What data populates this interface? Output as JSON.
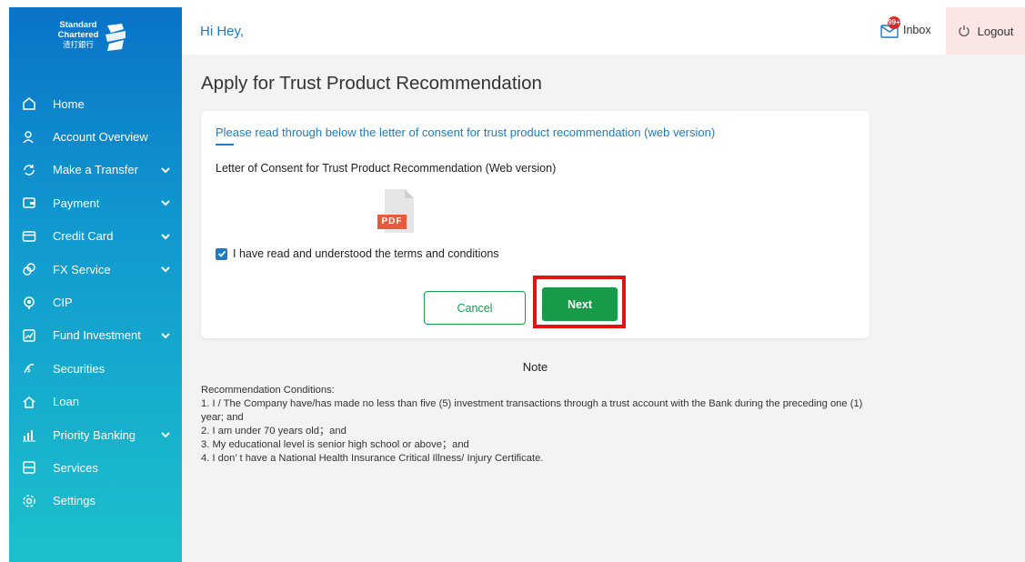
{
  "brand": {
    "line1": "Standard",
    "line2": "Chartered",
    "line3": "渣打銀行"
  },
  "sidebar": {
    "items": [
      {
        "label": "Home",
        "icon": "home-icon",
        "has_chevron": false
      },
      {
        "label": "Account Overview",
        "icon": "user-icon",
        "has_chevron": false
      },
      {
        "label": "Make a Transfer",
        "icon": "transfer-icon",
        "has_chevron": true
      },
      {
        "label": "Payment",
        "icon": "wallet-icon",
        "has_chevron": true
      },
      {
        "label": "Credit Card",
        "icon": "credit-card-icon",
        "has_chevron": true
      },
      {
        "label": "FX Service",
        "icon": "fx-icon",
        "has_chevron": true
      },
      {
        "label": "CIP",
        "icon": "cip-icon",
        "has_chevron": false
      },
      {
        "label": "Fund Investment",
        "icon": "fund-icon",
        "has_chevron": true
      },
      {
        "label": "Securities",
        "icon": "securities-icon",
        "has_chevron": false
      },
      {
        "label": "Loan",
        "icon": "loan-icon",
        "has_chevron": false
      },
      {
        "label": "Priority Banking",
        "icon": "priority-banking-icon",
        "has_chevron": true
      },
      {
        "label": "Services",
        "icon": "services-icon",
        "has_chevron": false
      },
      {
        "label": "Settings",
        "icon": "settings-icon",
        "has_chevron": false
      }
    ]
  },
  "header": {
    "greeting": "Hi Hey,",
    "inbox_label": "Inbox",
    "inbox_badge": "99+",
    "logout_label": "Logout"
  },
  "main": {
    "title": "Apply for Trust Product Recommendation",
    "consent_link": "Please read through below the letter of consent for trust product recommendation (web version)",
    "document_title": "Letter of Consent for Trust Product Recommendation (Web version)",
    "pdf_label": "PDF",
    "agree_label": "I have read and understood the terms and conditions",
    "agree_checked": true,
    "cancel_label": "Cancel",
    "next_label": "Next"
  },
  "note": {
    "title": "Note",
    "heading": "Recommendation Conditions:",
    "conditions": [
      "1. I / The Company have/has made no less than five (5) investment transactions through a trust account with the Bank during the preceding one (1) year;  and",
      "2. I am under 70 years old；and",
      "3. My educational level is  senior high school or above；and",
      "4. I don’ t have a National Health Insurance Critical Illness/ Injury Certificate."
    ]
  },
  "colors": {
    "sidebar_top": "#0a73c8",
    "sidebar_bottom": "#1cc0cc",
    "accent_blue": "#1e7bc6",
    "next_green": "#169b48",
    "highlight_red": "#e31313",
    "logout_bg": "#fbe6e6"
  }
}
